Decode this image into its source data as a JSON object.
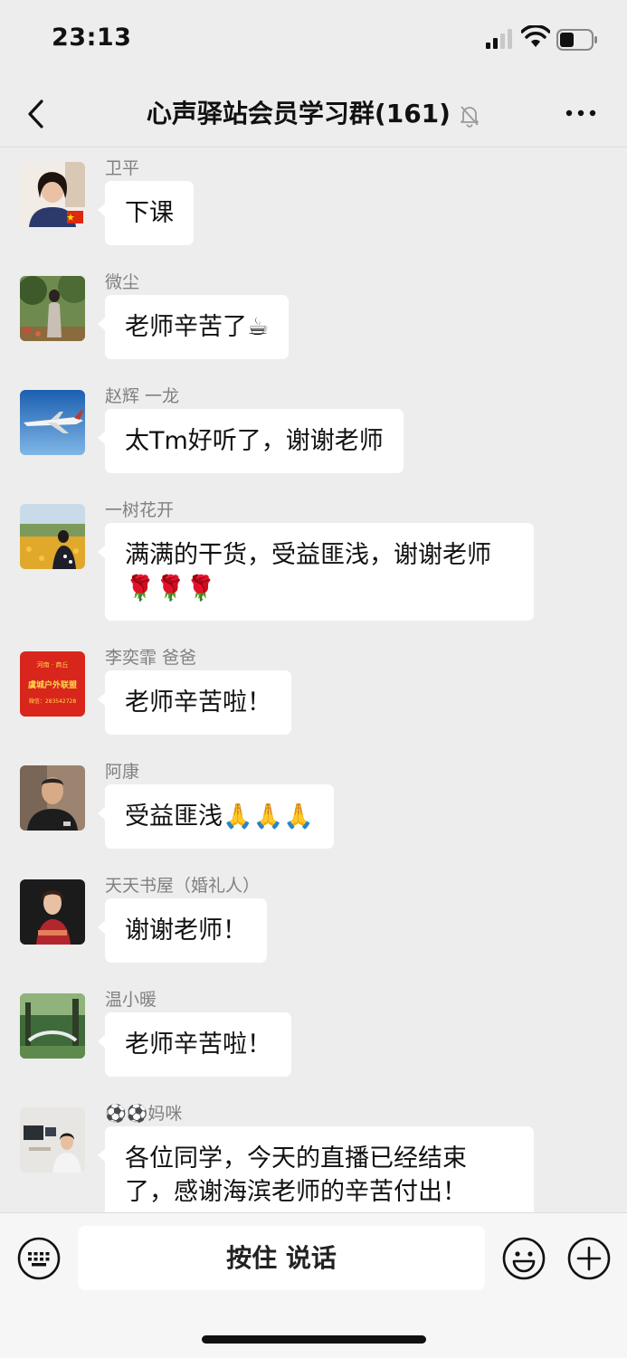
{
  "status_bar": {
    "time": "23:13"
  },
  "nav": {
    "title": "心声驿站会员学习群(161)"
  },
  "messages": [
    {
      "sender": "卫平",
      "text": "下课"
    },
    {
      "sender": "微尘",
      "text": "老师辛苦了☕"
    },
    {
      "sender": "赵辉 一龙",
      "text": "太Tm好听了，谢谢老师"
    },
    {
      "sender": "一树花开",
      "text": "满满的干货，受益匪浅，谢谢老师🌹🌹🌹"
    },
    {
      "sender": "李奕霏  爸爸",
      "text": "老师辛苦啦！",
      "avatar_text": [
        "河南 · 商丘",
        "虞城户外联盟",
        "微信：283542728"
      ]
    },
    {
      "sender": "阿康",
      "text": "受益匪浅🙏🙏🙏"
    },
    {
      "sender": "天天书屋（婚礼人）",
      "text": "谢谢老师！"
    },
    {
      "sender": "温小暖",
      "text": "老师辛苦啦！"
    },
    {
      "sender": "⚽⚽妈咪",
      "text": "各位同学，今天的直播已经结束了，感谢海滨老师的辛苦付出！"
    }
  ],
  "input_bar": {
    "hold_to_talk": "按住 说话"
  },
  "icons": {
    "back": "chevron-left-icon",
    "mute": "bell-off-icon",
    "more": "more-dots-icon",
    "keyboard": "keyboard-icon",
    "emoji": "smiley-icon",
    "plus": "plus-circle-icon"
  },
  "colors": {
    "background": "#ededed",
    "bubble": "#ffffff",
    "sender_name": "#808080"
  }
}
